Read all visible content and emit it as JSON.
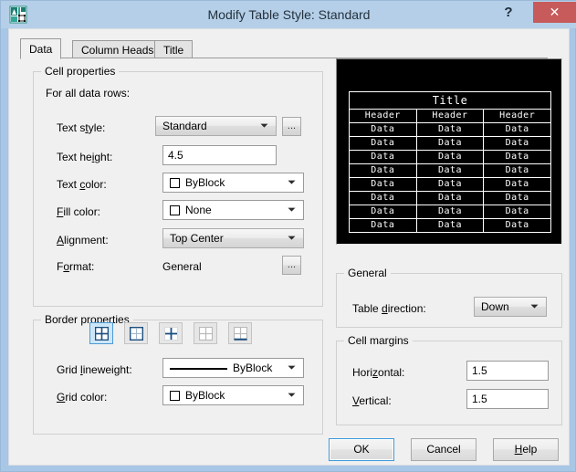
{
  "window": {
    "title": "Modify Table Style: Standard",
    "icon_name": "autocad-table-style-icon",
    "help_label": "?",
    "close_label": "✕"
  },
  "tabs": [
    {
      "label": "Data",
      "active": true
    },
    {
      "label": "Column Heads",
      "active": false
    },
    {
      "label": "Title",
      "active": false
    }
  ],
  "cell_properties": {
    "group_title": "Cell properties",
    "subtitle": "For all data rows:",
    "text_style": {
      "label": "Text style:",
      "value": "Standard",
      "browse": "..."
    },
    "text_height": {
      "label": "Text height:",
      "value": "4.5"
    },
    "text_color": {
      "label": "Text color:",
      "value": "ByBlock",
      "swatch": "#ffffff"
    },
    "fill_color": {
      "label": "Fill color:",
      "value": "None",
      "swatch": "#ffffff"
    },
    "alignment": {
      "label": "Alignment:",
      "value": "Top Center"
    },
    "format": {
      "label": "Format:",
      "value": "General",
      "browse": "..."
    }
  },
  "border_properties": {
    "group_title": "Border properties",
    "buttons": [
      {
        "name": "all-borders",
        "selected": true
      },
      {
        "name": "outside-borders",
        "selected": false
      },
      {
        "name": "inside-borders",
        "selected": false
      },
      {
        "name": "no-borders",
        "selected": false
      },
      {
        "name": "bottom-border",
        "selected": false
      }
    ],
    "grid_lineweight": {
      "label": "Grid lineweight:",
      "value": "ByBlock"
    },
    "grid_color": {
      "label": "Grid color:",
      "value": "ByBlock",
      "swatch": "#ffffff"
    }
  },
  "preview": {
    "background": "#000000",
    "foreground": "#ffffff",
    "title_row": "Title",
    "header_row": [
      "Header",
      "Header",
      "Header"
    ],
    "data_rows": [
      [
        "Data",
        "Data",
        "Data"
      ],
      [
        "Data",
        "Data",
        "Data"
      ],
      [
        "Data",
        "Data",
        "Data"
      ],
      [
        "Data",
        "Data",
        "Data"
      ],
      [
        "Data",
        "Data",
        "Data"
      ],
      [
        "Data",
        "Data",
        "Data"
      ],
      [
        "Data",
        "Data",
        "Data"
      ],
      [
        "Data",
        "Data",
        "Data"
      ]
    ]
  },
  "general": {
    "group_title": "General",
    "table_direction": {
      "label": "Table direction:",
      "value": "Down"
    }
  },
  "cell_margins": {
    "group_title": "Cell margins",
    "horizontal": {
      "label": "Horizontal:",
      "value": "1.5"
    },
    "vertical": {
      "label": "Vertical:",
      "value": "1.5"
    }
  },
  "footer": {
    "ok": "OK",
    "cancel": "Cancel",
    "help": "Help"
  }
}
